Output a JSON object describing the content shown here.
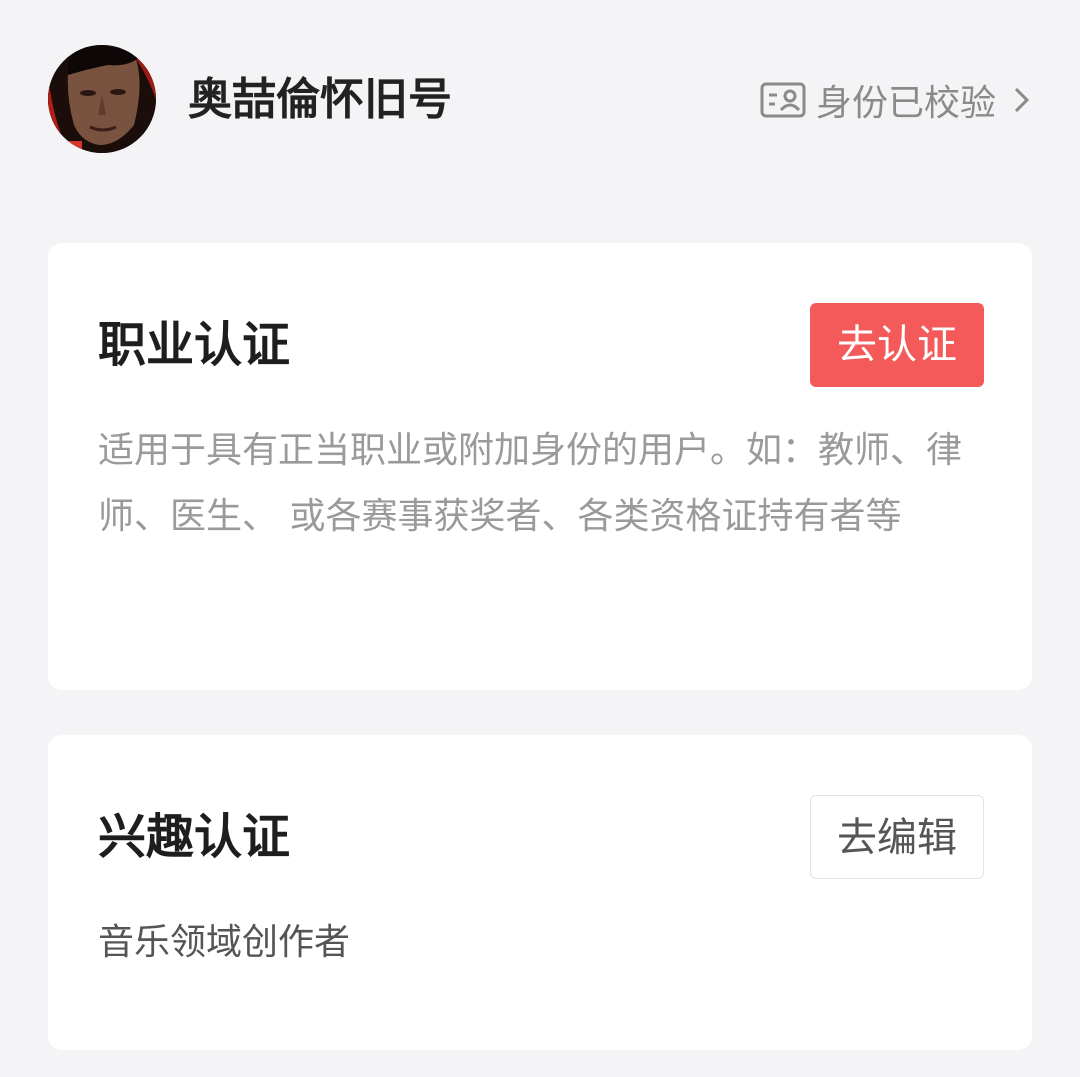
{
  "header": {
    "username": "奥喆倫怀旧号",
    "verify_label": "身份已校验",
    "verify_icon": "id-card-icon",
    "chevron_icon": "chevron-right-icon"
  },
  "professional": {
    "title": "职业认证",
    "button_label": "去认证",
    "description": "适用于具有正当职业或附加身份的用户。如：教师、律师、医生、 或各赛事获奖者、各类资格证持有者等"
  },
  "interest": {
    "title": "兴趣认证",
    "button_label": "去编辑",
    "value": "音乐领域创作者"
  },
  "colors": {
    "background": "#f4f4f6",
    "accent": "#f45a5a",
    "card": "#ffffff"
  }
}
